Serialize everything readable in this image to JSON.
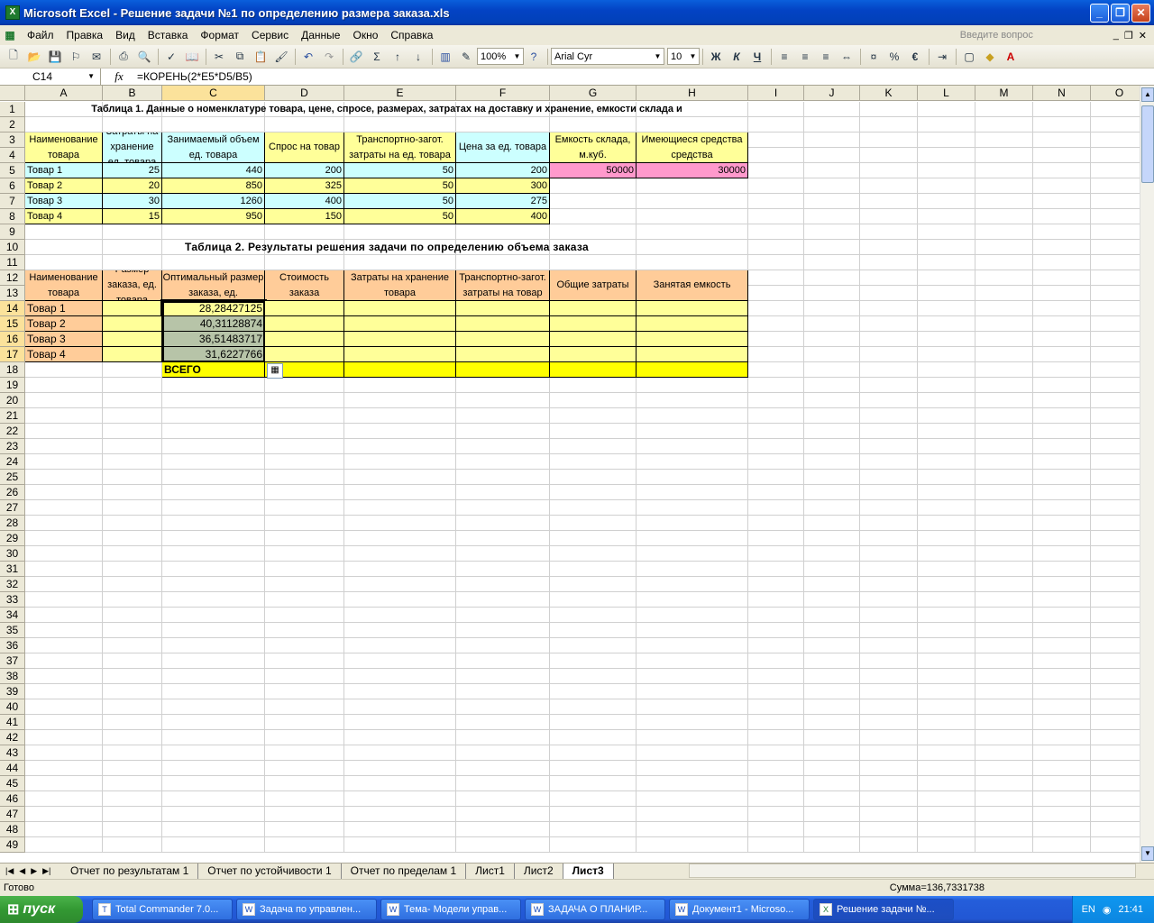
{
  "window": {
    "title": "Microsoft Excel - Решение задачи №1 по определению размера заказа.xls"
  },
  "menu": {
    "items": [
      "Файл",
      "Правка",
      "Вид",
      "Вставка",
      "Формат",
      "Сервис",
      "Данные",
      "Окно",
      "Справка"
    ],
    "ask_placeholder": "Введите вопрос"
  },
  "toolbar": {
    "zoom": "100%",
    "font": "Arial Cyr",
    "font_size": "10",
    "bold": "Ж",
    "italic": "К",
    "underline": "Ч",
    "sum": "Σ",
    "percent": "%",
    "euro": "€"
  },
  "formula_bar": {
    "cell_ref": "C14",
    "fx": "fx",
    "formula": "=КОРЕНЬ(2*E5*D5/B5)"
  },
  "columns": [
    "A",
    "B",
    "C",
    "D",
    "E",
    "F",
    "G",
    "H",
    "I",
    "J",
    "K",
    "L",
    "M",
    "N",
    "O"
  ],
  "rows": [
    "1",
    "2",
    "3",
    "4",
    "5",
    "6",
    "7",
    "8",
    "9",
    "10",
    "11",
    "12",
    "13",
    "14",
    "15",
    "16",
    "17",
    "18",
    "19",
    "20",
    "21",
    "22",
    "23",
    "24",
    "25",
    "26",
    "27",
    "28",
    "29",
    "30",
    "31",
    "32",
    "33",
    "34",
    "35",
    "36",
    "37",
    "38",
    "39",
    "40",
    "41",
    "42",
    "43",
    "44",
    "45",
    "46",
    "47",
    "48",
    "49"
  ],
  "sheet": {
    "title1": "Таблица 1. Данные о номенклатуре товара, цене, спросе, размерах, затратах на доставку и хранение, емкости склада и",
    "t1_headers": [
      "Наименование товара",
      "Затраты на хранение ед. товара",
      "Занимаемый объем ед. товара",
      "Спрос на товар",
      "Транспортно-загот. затраты на ед. товара",
      "Цена за ед. товара",
      "Емкость склада, м.куб.",
      "Имеющиеся средства средства"
    ],
    "t1_rows": [
      {
        "name": "Товар 1",
        "b": "25",
        "c": "440",
        "d": "200",
        "e": "50",
        "f": "200",
        "g": "50000",
        "h": "30000"
      },
      {
        "name": "Товар 2",
        "b": "20",
        "c": "850",
        "d": "325",
        "e": "50",
        "f": "300"
      },
      {
        "name": "Товар 3",
        "b": "30",
        "c": "1260",
        "d": "400",
        "e": "50",
        "f": "275"
      },
      {
        "name": "Товар 4",
        "b": "15",
        "c": "950",
        "d": "150",
        "e": "50",
        "f": "400"
      }
    ],
    "title2": "Таблица 2. Результаты решения задачи по определению объема заказа",
    "t2_headers": [
      "Наименование товара",
      "Размер заказа, ед. товара",
      "Оптимальный размер заказа, ед.",
      "Стоимость заказа",
      "Затраты на хранение товара",
      "Транспортно-загот. затраты на товар",
      "Общие затраты",
      "Занятая емкость"
    ],
    "t2_rows": [
      {
        "name": "Товар 1",
        "c": "28,28427125"
      },
      {
        "name": "Товар 2",
        "c": "40,31128874"
      },
      {
        "name": "Товар 3",
        "c": "36,51483717"
      },
      {
        "name": "Товар 4",
        "c": "31,6227766"
      }
    ],
    "total_label": "ВСЕГО"
  },
  "tabs": [
    "Отчет по результатам 1",
    "Отчет по устойчивости 1",
    "Отчет по пределам 1",
    "Лист1",
    "Лист2",
    "Лист3"
  ],
  "status": {
    "left": "Готово",
    "sum": "Сумма=136,7331738"
  },
  "taskbar": {
    "start": "пуск",
    "tasks": [
      "Total Commander 7.0...",
      "Задача по управлен...",
      "Тема- Модели управ...",
      "ЗАДАЧА О ПЛАНИР...",
      "Документ1 - Microso...",
      "Решение задачи №..."
    ],
    "lang": "EN",
    "clock": "21:41"
  },
  "colors": {
    "cyan": "#ccffff",
    "yellow": "#ffff99",
    "pink": "#ff99cc",
    "peach": "#ffcc99",
    "bright_yellow": "#ffff00",
    "selected": "#b7c4a8"
  }
}
